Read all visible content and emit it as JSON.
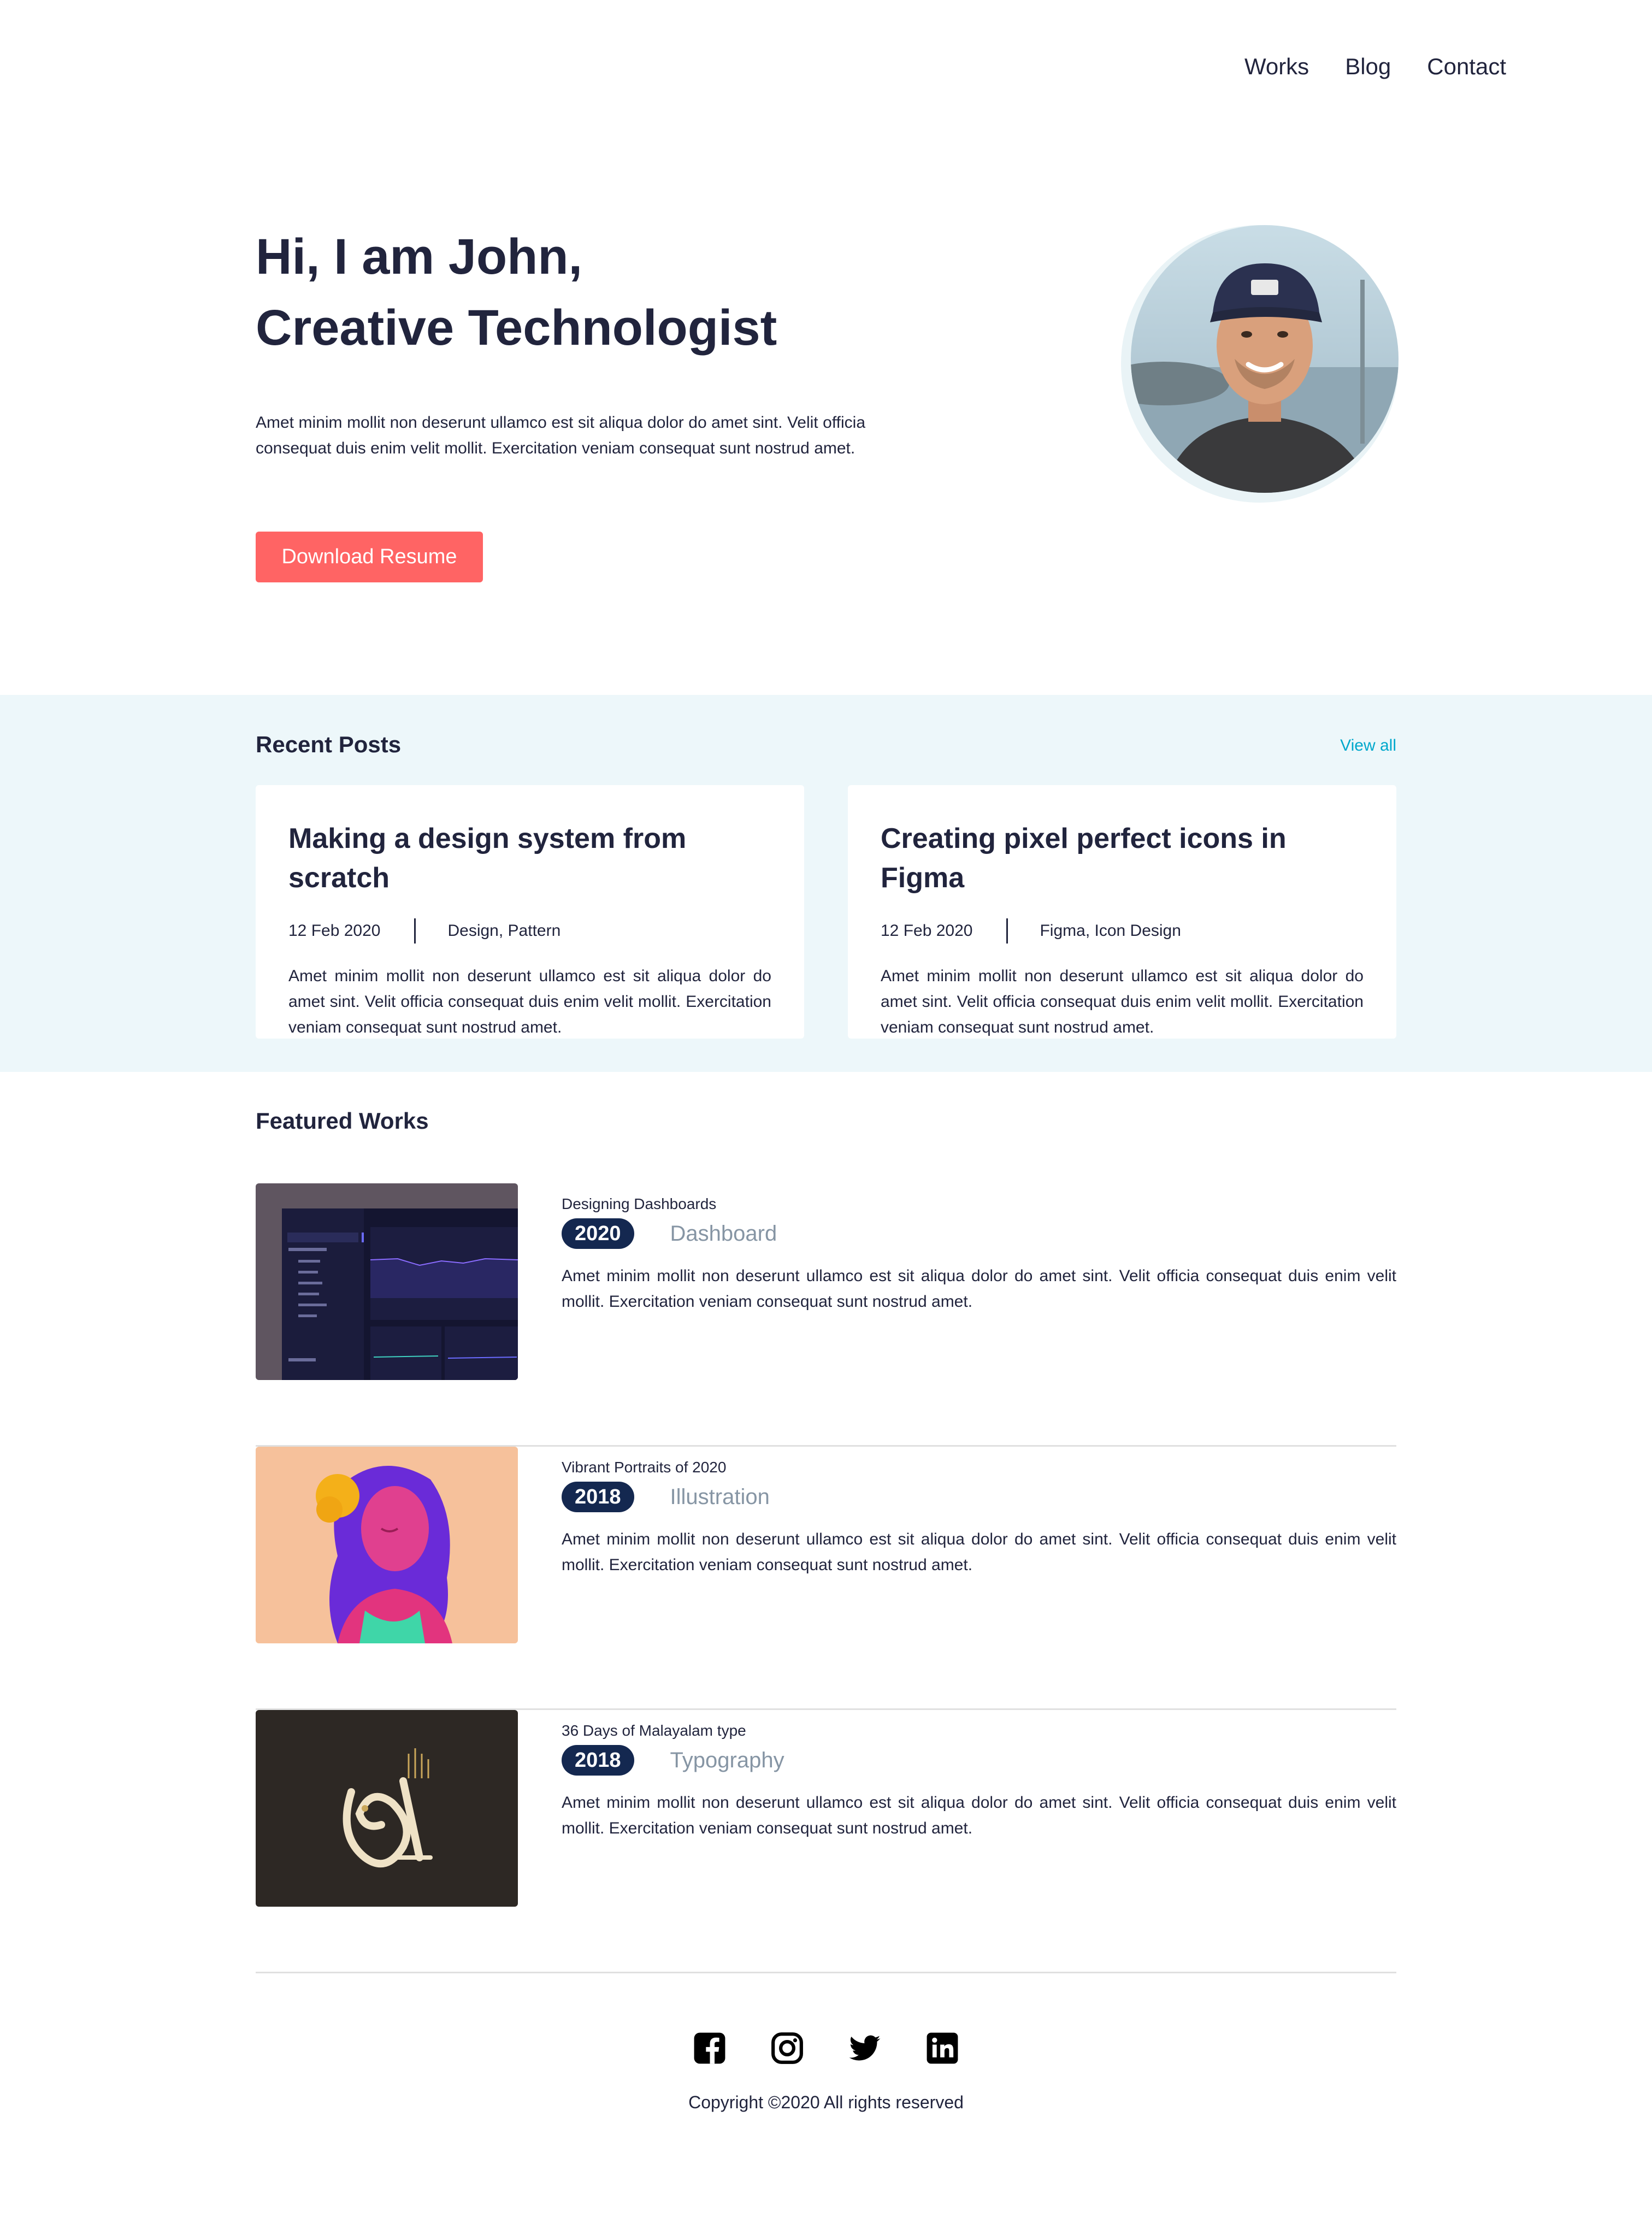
{
  "nav": {
    "items": [
      "Works",
      "Blog",
      "Contact"
    ]
  },
  "hero": {
    "title_line1": "Hi, I am John,",
    "title_line2": "Creative Technologist",
    "text": "Amet minim mollit non deserunt ullamco est sit aliqua dolor do amet sint. Velit officia consequat duis enim velit mollit. Exercitation veniam consequat sunt nostrud amet.",
    "button": "Download Resume"
  },
  "recent_posts": {
    "title": "Recent Posts",
    "view_all": "View all",
    "posts": [
      {
        "title": "Making a design system from scratch",
        "date": "12 Feb 2020",
        "tags": "Design, Pattern",
        "excerpt": "Amet minim mollit non deserunt ullamco est sit aliqua dolor do amet sint. Velit officia consequat duis enim velit mollit. Exercitation veniam consequat sunt nostrud amet."
      },
      {
        "title": "Creating pixel perfect icons in Figma",
        "date": "12 Feb 2020",
        "tags": "Figma, Icon Design",
        "excerpt": "Amet minim mollit non deserunt ullamco est sit aliqua dolor do amet sint. Velit officia consequat duis enim velit mollit. Exercitation veniam consequat sunt nostrud amet."
      }
    ]
  },
  "featured_works": {
    "title": "Featured Works",
    "works": [
      {
        "subtitle": "Designing Dashboards",
        "year": "2020",
        "category": "Dashboard",
        "description": "Amet minim mollit non deserunt ullamco est sit aliqua dolor do amet sint. Velit officia consequat duis enim velit mollit. Exercitation veniam consequat sunt nostrud amet."
      },
      {
        "subtitle": "Vibrant Portraits of 2020",
        "year": "2018",
        "category": "Illustration",
        "description": "Amet minim mollit non deserunt ullamco est sit aliqua dolor do amet sint. Velit officia consequat duis enim velit mollit. Exercitation veniam consequat sunt nostrud amet."
      },
      {
        "subtitle": "36 Days of Malayalam type",
        "year": "2018",
        "category": "Typography",
        "description": "Amet minim mollit non deserunt ullamco est sit aliqua dolor do amet sint. Velit officia consequat duis enim velit mollit. Exercitation veniam consequat sunt nostrud amet."
      }
    ]
  },
  "footer": {
    "icons": [
      "facebook-icon",
      "instagram-icon",
      "twitter-icon",
      "linkedin-icon"
    ],
    "copyright": "Copyright ©2020 All rights reserved"
  },
  "colors": {
    "primary": "#21243d",
    "accent": "#ff6464",
    "link": "#00a8cc",
    "badge": "#142850",
    "band": "#edf7fa",
    "muted": "#8695a4"
  }
}
